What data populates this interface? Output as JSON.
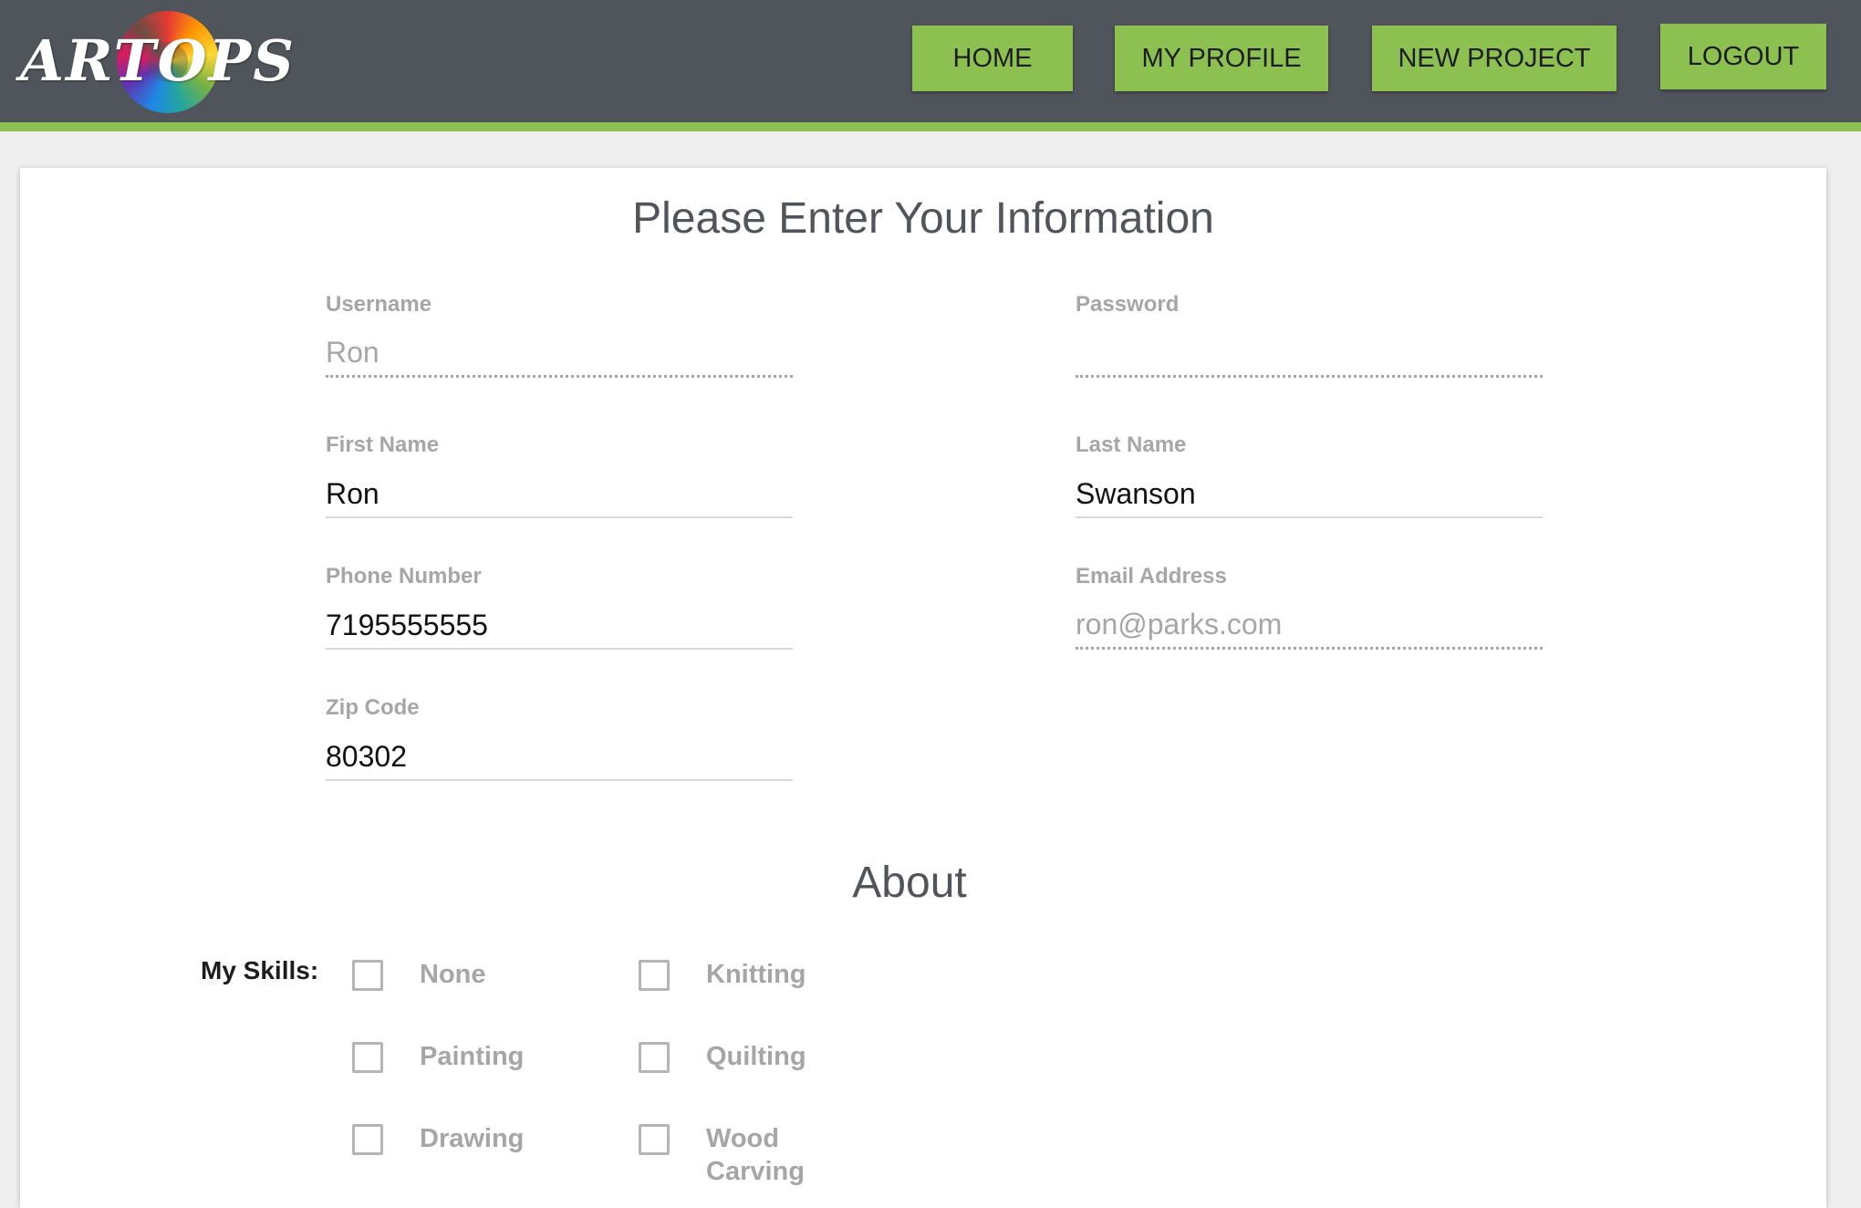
{
  "header": {
    "logo": "ARTOPS",
    "nav": {
      "home": "HOME",
      "my_profile": "MY PROFILE",
      "new_project": "NEW PROJECT",
      "logout": "LOGOUT"
    }
  },
  "form": {
    "title": "Please Enter Your Information",
    "username": {
      "label": "Username",
      "value": "Ron"
    },
    "password": {
      "label": "Password",
      "value": ""
    },
    "first_name": {
      "label": "First Name",
      "value": "Ron"
    },
    "last_name": {
      "label": "Last Name",
      "value": "Swanson"
    },
    "phone": {
      "label": "Phone Number",
      "value": "7195555555"
    },
    "email": {
      "label": "Email Address",
      "value": "ron@parks.com"
    },
    "zip": {
      "label": "Zip Code",
      "value": "80302"
    }
  },
  "about": {
    "title": "About",
    "skills_label": "My Skills:",
    "skills": [
      {
        "label": "None",
        "checked": false
      },
      {
        "label": "Knitting",
        "checked": false
      },
      {
        "label": "Painting",
        "checked": false
      },
      {
        "label": "Quilting",
        "checked": false
      },
      {
        "label": "Drawing",
        "checked": false
      },
      {
        "label": "Wood Carving",
        "checked": false
      }
    ]
  },
  "colors": {
    "header_bg": "#4f555a",
    "accent_green": "#8cc152",
    "label_gray": "#a6a6a6"
  }
}
